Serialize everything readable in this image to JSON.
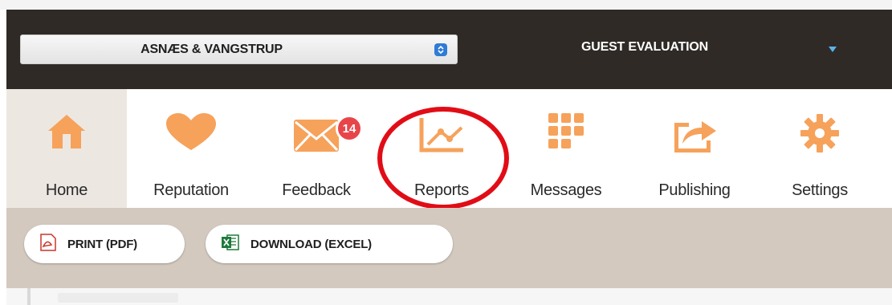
{
  "header": {
    "property_select": {
      "label": "ASNÆS & VANGSTRUP"
    },
    "evaluation": {
      "label": "GUEST EVALUATION"
    }
  },
  "nav": {
    "items": [
      {
        "label": "Home",
        "icon": "home-icon",
        "active": true
      },
      {
        "label": "Reputation",
        "icon": "heart-icon"
      },
      {
        "label": "Feedback",
        "icon": "envelope-icon",
        "badge": "14"
      },
      {
        "label": "Reports",
        "icon": "line-chart-icon"
      },
      {
        "label": "Messages",
        "icon": "grid-icon"
      },
      {
        "label": "Publishing",
        "icon": "share-icon"
      },
      {
        "label": "Settings",
        "icon": "gear-icon"
      }
    ]
  },
  "toolbar": {
    "print_label": "PRINT (PDF)",
    "download_label": "DOWNLOAD (EXCEL)"
  },
  "colors": {
    "header_bg": "#2f2a26",
    "icon_orange": "#f6a25b",
    "active_tab_bg": "#ede7e1",
    "toolbar_bg": "#d3c9bf",
    "badge_red": "#e8454a",
    "annotation_red": "#e10d16"
  }
}
